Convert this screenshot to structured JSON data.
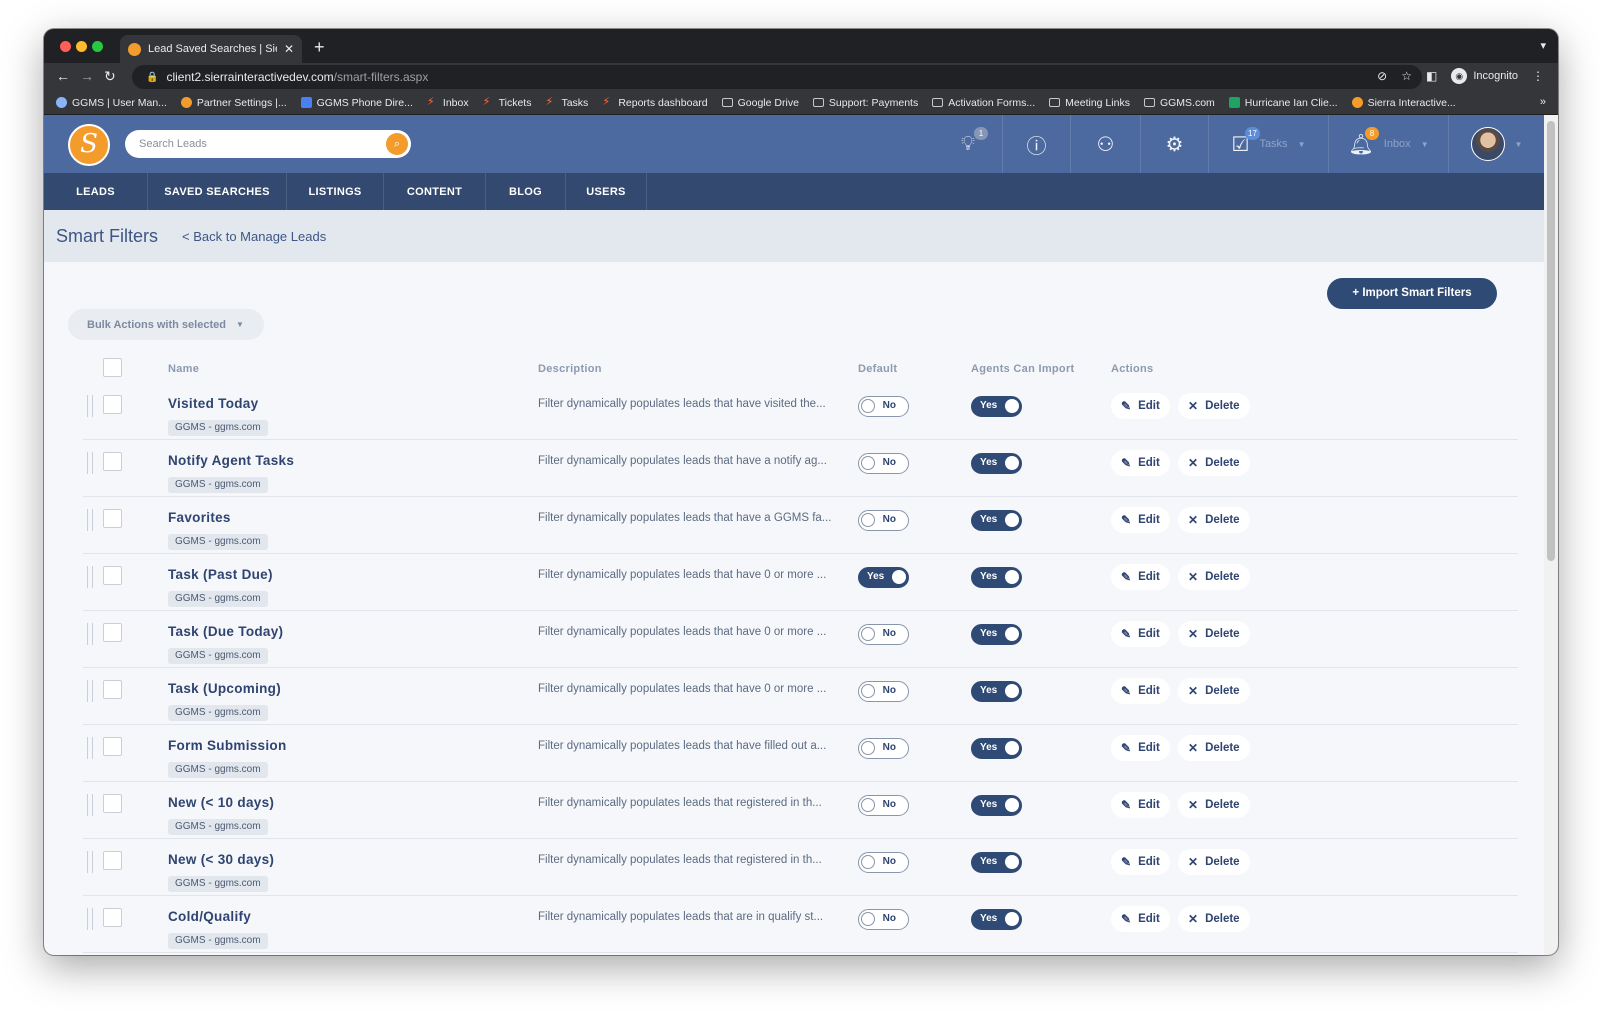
{
  "browser": {
    "tab_title": "Lead Saved Searches | Sierra I",
    "url_host": "client2.sierrainteractivedev.com",
    "url_path": "/smart-filters.aspx",
    "profile_label": "Incognito",
    "bookmarks": [
      {
        "label": "GGMS | User Man...",
        "icon": "blue"
      },
      {
        "label": "Partner Settings |...",
        "icon": "orange"
      },
      {
        "label": "GGMS Phone Dire...",
        "icon": "doc"
      },
      {
        "label": "Inbox",
        "icon": "red"
      },
      {
        "label": "Tickets",
        "icon": "red"
      },
      {
        "label": "Tasks",
        "icon": "red"
      },
      {
        "label": "Reports dashboard",
        "icon": "red"
      },
      {
        "label": "Google Drive",
        "icon": "folder"
      },
      {
        "label": "Support: Payments",
        "icon": "folder"
      },
      {
        "label": "Activation Forms...",
        "icon": "folder"
      },
      {
        "label": "Meeting Links",
        "icon": "folder"
      },
      {
        "label": "GGMS.com",
        "icon": "folder"
      },
      {
        "label": "Hurricane Ian Clie...",
        "icon": "green"
      },
      {
        "label": "Sierra Interactive...",
        "icon": "orange"
      }
    ]
  },
  "header": {
    "logo_glyph": "S",
    "search_placeholder": "Search Leads",
    "ideas_badge": "1",
    "tasks_label": "Tasks",
    "tasks_badge": "17",
    "inbox_label": "Inbox",
    "inbox_badge": "8"
  },
  "nav": {
    "items": [
      "LEADS",
      "SAVED SEARCHES",
      "LISTINGS",
      "CONTENT",
      "BLOG",
      "USERS"
    ]
  },
  "page": {
    "title": "Smart Filters",
    "back_link": "< Back to Manage Leads",
    "import_button": "+ Import Smart Filters",
    "bulk_actions": "Bulk Actions with selected"
  },
  "table": {
    "columns": {
      "name": "Name",
      "description": "Description",
      "default": "Default",
      "agents_can_import": "Agents Can Import",
      "actions": "Actions"
    },
    "edit_label": "Edit",
    "delete_label": "Delete",
    "rows": [
      {
        "name": "Visited Today",
        "tag": "GGMS - ggms.com",
        "description": "Filter dynamically populates leads that have visited the...",
        "default": "No",
        "agents_can_import": "Yes"
      },
      {
        "name": "Notify Agent Tasks",
        "tag": "GGMS - ggms.com",
        "description": "Filter dynamically populates leads that have a notify ag...",
        "default": "No",
        "agents_can_import": "Yes"
      },
      {
        "name": "Favorites",
        "tag": "GGMS - ggms.com",
        "description": "Filter dynamically populates leads that have a GGMS fa...",
        "default": "No",
        "agents_can_import": "Yes"
      },
      {
        "name": "Task (Past Due)",
        "tag": "GGMS - ggms.com",
        "description": "Filter dynamically populates leads that have 0 or more ...",
        "default": "Yes",
        "agents_can_import": "Yes"
      },
      {
        "name": "Task (Due Today)",
        "tag": "GGMS - ggms.com",
        "description": "Filter dynamically populates leads that have 0 or more ...",
        "default": "No",
        "agents_can_import": "Yes"
      },
      {
        "name": "Task (Upcoming)",
        "tag": "GGMS - ggms.com",
        "description": "Filter dynamically populates leads that have 0 or more ...",
        "default": "No",
        "agents_can_import": "Yes"
      },
      {
        "name": "Form Submission",
        "tag": "GGMS - ggms.com",
        "description": "Filter dynamically populates leads that have filled out a...",
        "default": "No",
        "agents_can_import": "Yes"
      },
      {
        "name": "New (< 10 days)",
        "tag": "GGMS - ggms.com",
        "description": "Filter dynamically populates leads that registered in th...",
        "default": "No",
        "agents_can_import": "Yes"
      },
      {
        "name": "New (< 30 days)",
        "tag": "GGMS - ggms.com",
        "description": "Filter dynamically populates leads that registered in th...",
        "default": "No",
        "agents_can_import": "Yes"
      },
      {
        "name": "Cold/Qualify",
        "tag": "GGMS - ggms.com",
        "description": "Filter dynamically populates leads that are in qualify st...",
        "default": "No",
        "agents_can_import": "Yes"
      }
    ]
  },
  "colors": {
    "header_bg": "#4d6aa0",
    "nav_bg": "#33496f",
    "accent_orange": "#f39c2b",
    "primary_dark": "#2f4a74"
  }
}
